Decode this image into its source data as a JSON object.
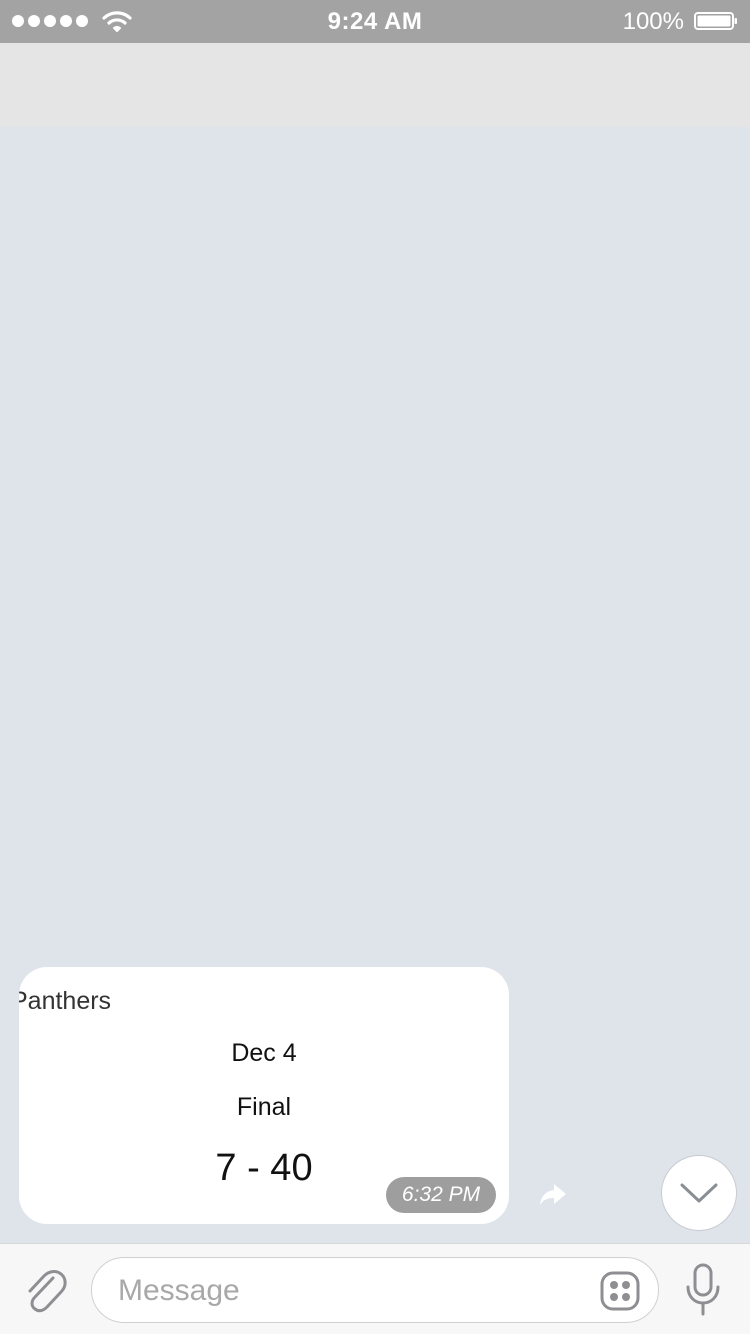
{
  "status_bar": {
    "time": "9:24 AM",
    "battery_percent": "100%",
    "signal_bars": 5
  },
  "message": {
    "team": "Panthers",
    "date": "Dec 4",
    "status": "Final",
    "score": "7 - 40",
    "timestamp": "6:32 PM"
  },
  "input": {
    "placeholder": "Message"
  },
  "icons": {
    "wifi": "wifi-icon",
    "battery": "battery-icon",
    "share": "share-arrow-icon",
    "scroll_down": "chevron-down-icon",
    "attach": "paperclip-icon",
    "sticker": "sticker-icon",
    "mic": "microphone-icon"
  },
  "colors": {
    "status_bar": "#a3a3a3",
    "header": "#e5e5e5",
    "chat_background": "#dfe3ea",
    "bubble": "#ffffff",
    "timestamp_badge": "#787878"
  }
}
